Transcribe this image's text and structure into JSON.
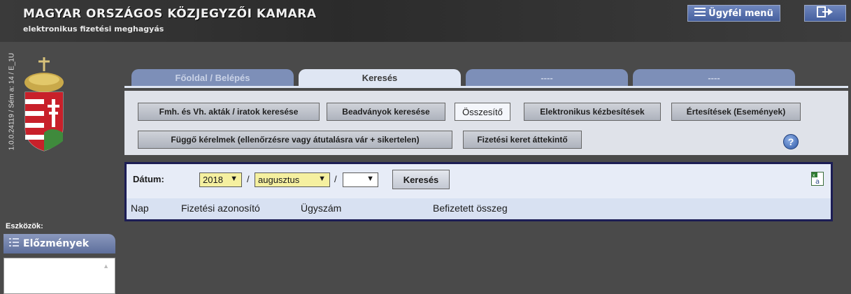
{
  "header": {
    "title": "MAGYAR ORSZÁGOS KÖZJEGYZŐI KAMARA",
    "subtitle": "elektronikus fizetési meghagyás",
    "client_menu_label": "Ügyfél menü",
    "client_menu_icon": "hamburger-icon",
    "logout_icon": "logout-icon"
  },
  "version": "1.0.0.24119 / Sém a: 14 / E_1U",
  "tabs": [
    {
      "label": "Főoldal / Belépés",
      "active": false
    },
    {
      "label": "Keresés",
      "active": true
    },
    {
      "label": "----",
      "active": false
    },
    {
      "label": "----",
      "active": false
    }
  ],
  "subtabs": [
    {
      "label": "Fmh. és Vh. akták / iratok keresése",
      "active": false
    },
    {
      "label": "Beadványok keresése",
      "active": false
    },
    {
      "label": "Összesítő",
      "active": true
    },
    {
      "label": "Elektronikus kézbesítések",
      "active": false
    },
    {
      "label": "Értesítések (Események)",
      "active": false
    },
    {
      "label": "Függő kérelmek (ellenőrzésre vagy átutalásra vár + sikertelen)",
      "active": false
    },
    {
      "label": "Fizetési keret áttekintő",
      "active": false
    }
  ],
  "filter": {
    "date_label": "Dátum:",
    "year": "2018",
    "month": "augusztus",
    "day": "",
    "separator": "/",
    "search_button": "Keresés"
  },
  "table": {
    "columns": [
      "Nap",
      "Fizetési azonosító",
      "Ügyszám",
      "Befizetett összeg"
    ]
  },
  "sidebar": {
    "tools_label": "Eszközök:",
    "history_label": "Előzmények"
  },
  "help_icon": "help-icon",
  "export_icon": "excel-export-icon"
}
